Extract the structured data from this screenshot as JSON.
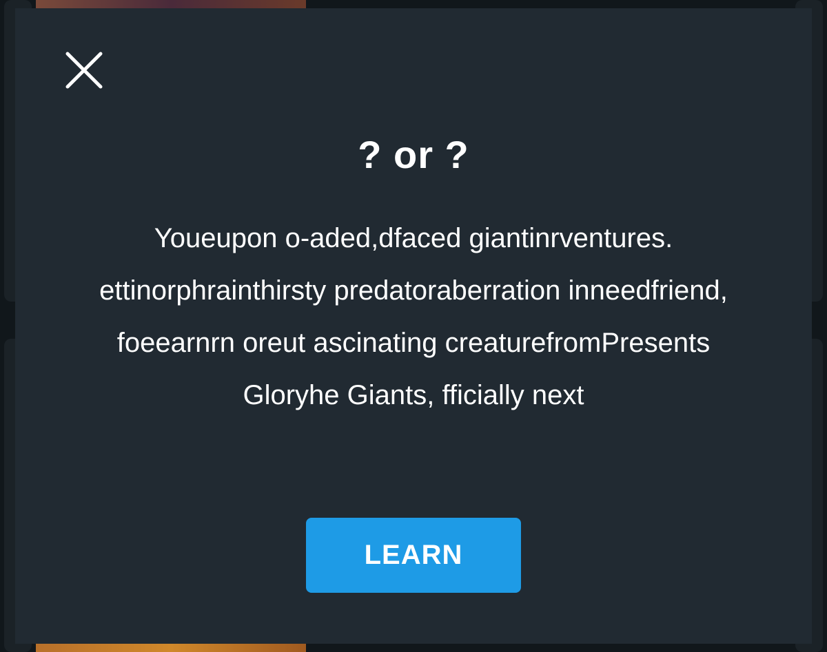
{
  "modal": {
    "title": "? or ?",
    "body_lines": [
      "Youeupon o-aded,dfaced giantinrventures.",
      "ettinorphrainthirsty predatoraberration inneedfriend,",
      "foeearnrn oreut ascinating creaturefromPresents",
      "Gloryhe Giants, fficially next"
    ],
    "learn_label": "LEARN",
    "close_icon": "close-icon"
  },
  "colors": {
    "modal_background": "#212a32",
    "button_accent": "#1e9be6",
    "text": "#ffffff"
  }
}
